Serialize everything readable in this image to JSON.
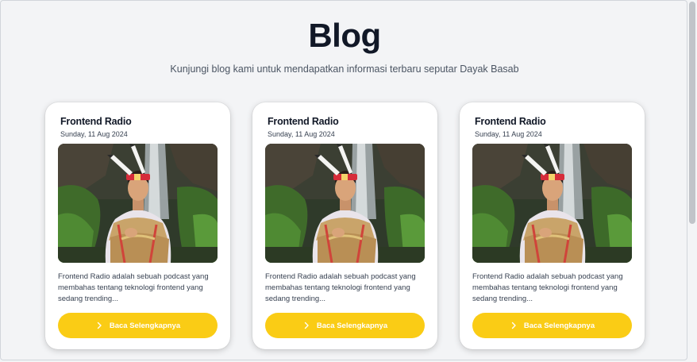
{
  "header": {
    "title": "Blog",
    "subtitle": "Kunjungi blog kami untuk mendapatkan informasi terbaru seputar Dayak Basab"
  },
  "cards": [
    {
      "title": "Frontend Radio",
      "date": "Sunday, 11 Aug 2024",
      "excerpt": "Frontend Radio adalah sebuah podcast yang membahas tentang teknologi frontend yang sedang trending...",
      "button_label": "Baca Selengkapnya",
      "image": "photo-dayak-woman-traditional-costume-waterfall"
    },
    {
      "title": "Frontend Radio",
      "date": "Sunday, 11 Aug 2024",
      "excerpt": "Frontend Radio adalah sebuah podcast yang membahas tentang teknologi frontend yang sedang trending...",
      "button_label": "Baca Selengkapnya",
      "image": "photo-dayak-woman-traditional-costume-waterfall"
    },
    {
      "title": "Frontend Radio",
      "date": "Sunday, 11 Aug 2024",
      "excerpt": "Frontend Radio adalah sebuah podcast yang membahas tentang teknologi frontend yang sedang trending...",
      "button_label": "Baca Selengkapnya",
      "image": "photo-dayak-woman-traditional-costume-waterfall"
    }
  ],
  "colors": {
    "background": "#f3f4f6",
    "card": "#ffffff",
    "button": "#facc15",
    "button_text": "#ffffff",
    "title": "#111827"
  },
  "icons": {
    "button_icon": "chevron-right-icon"
  }
}
